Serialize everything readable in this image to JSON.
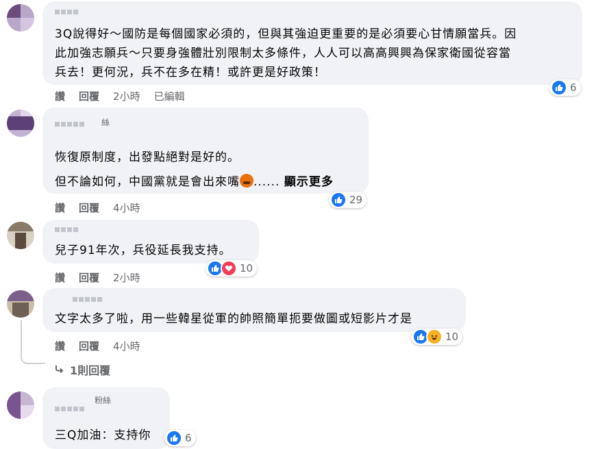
{
  "comments": [
    {
      "name_suffix": "",
      "text_lines": [
        "3Q說得好～國防是每個國家必須的，但與其強迫更重要的是必須要心甘情願當兵。因",
        "此加強志願兵～只要身強體壯別限制太多條件，人人可以高高興興為保家衛國從容當",
        "兵去！更何況，兵不在多在精！或許更是好政策！"
      ],
      "actions": {
        "like": "讚",
        "reply": "回覆",
        "time": "2小時",
        "edited": "已編輯"
      },
      "reactions": {
        "icons": [
          "like-icon"
        ],
        "count": "6"
      }
    },
    {
      "name_suffix": "絲",
      "text_lines": [
        "恢復原制度，出發點絕對是好的。",
        "但不論如何，中國黨就是會出來嘴"
      ],
      "ellipsis": "......",
      "see_more": "顯示更多",
      "actions": {
        "like": "讚",
        "reply": "回覆",
        "time": "4小時"
      },
      "reactions": {
        "icons": [
          "like-icon"
        ],
        "count": "29"
      }
    },
    {
      "name_suffix": "",
      "text_lines": [
        "兒子91年次，兵役延長我支持。"
      ],
      "actions": {
        "like": "讚",
        "reply": "回覆",
        "time": "2小時"
      },
      "reactions": {
        "icons": [
          "like-icon",
          "love-icon"
        ],
        "count": "10"
      }
    },
    {
      "name_suffix": "",
      "text_lines": [
        "文字太多了啦，用一些韓星從軍的帥照簡單扼要做圖或短影片才是"
      ],
      "actions": {
        "like": "讚",
        "reply": "回覆",
        "time": "4小時"
      },
      "reactions": {
        "icons": [
          "like-icon",
          "haha-icon"
        ],
        "count": "10"
      },
      "replies_label": "1則回覆"
    },
    {
      "name_suffix": "粉絲",
      "text_lines": [
        "三Q加油：支持你"
      ],
      "reactions": {
        "icons": [
          "like-icon"
        ],
        "count": "6"
      }
    }
  ],
  "colors": {
    "bubble": "#f0f2f5",
    "like": "#1877f2",
    "love": "#f33e58",
    "haha": "#f7b125",
    "meta": "#65676b"
  }
}
